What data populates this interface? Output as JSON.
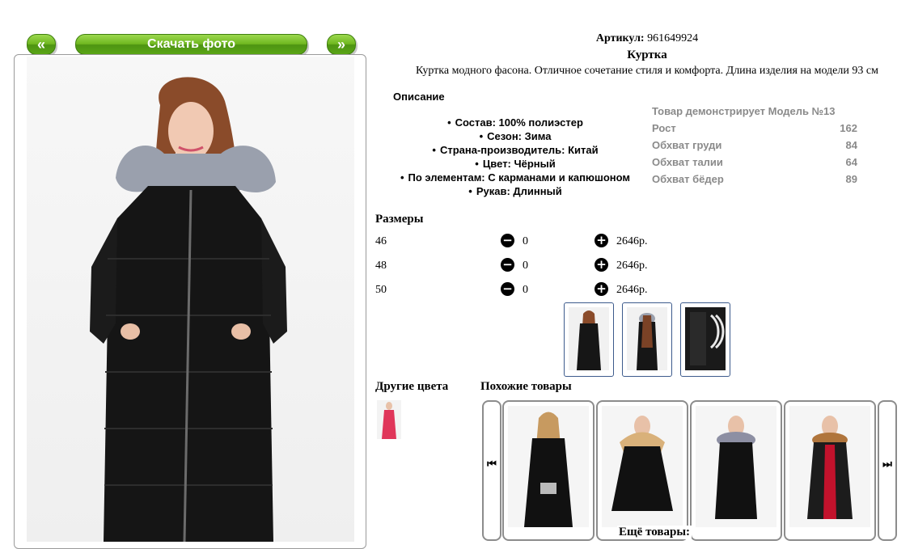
{
  "gallery": {
    "prev_label": "«",
    "download_label": "Скачать фото",
    "next_label": "»"
  },
  "product": {
    "article_label": "Артикул:",
    "article_value": "961649924",
    "title": "Куртка",
    "description": "Куртка модного фасона. Отличное сочетание стиля и комфорта. Длина изделия на модели 93 см",
    "description_heading": "Описание",
    "properties": [
      "Состав: 100% полиэстер",
      "Сезон: Зима",
      "Страна-производитель: Китай",
      "Цвет: Чёрный",
      "По элементам: С карманами и капюшоном",
      "Рукав: Длинный"
    ]
  },
  "model": {
    "heading": "Товар демонстрирует Модель №13",
    "rows": [
      {
        "label": "Рост",
        "value": "162"
      },
      {
        "label": "Обхват груди",
        "value": "84"
      },
      {
        "label": "Обхват талии",
        "value": "64"
      },
      {
        "label": "Обхват бёдер",
        "value": "89"
      }
    ]
  },
  "sizes": {
    "heading": "Размеры",
    "minus_icon": "minus-circle-icon",
    "plus_icon": "plus-circle-icon",
    "rows": [
      {
        "size": "46",
        "qty": "0",
        "price": "2646р."
      },
      {
        "size": "48",
        "qty": "0",
        "price": "2646р."
      },
      {
        "size": "50",
        "qty": "0",
        "price": "2646р."
      }
    ]
  },
  "other_colors": {
    "heading": "Другие цвета"
  },
  "similar": {
    "heading": "Похожие товары",
    "prev_icon": "skip-left-icon",
    "next_icon": "skip-right-icon",
    "prev_glyph": "⏮",
    "next_glyph": "⏭"
  },
  "more": {
    "label": "Ещё товары:"
  },
  "colors": {
    "button_green": "#6fb71f",
    "thumb_border": "#3d5b8c",
    "model_text": "#8a8a8a",
    "alt_color": "#e0365a"
  }
}
